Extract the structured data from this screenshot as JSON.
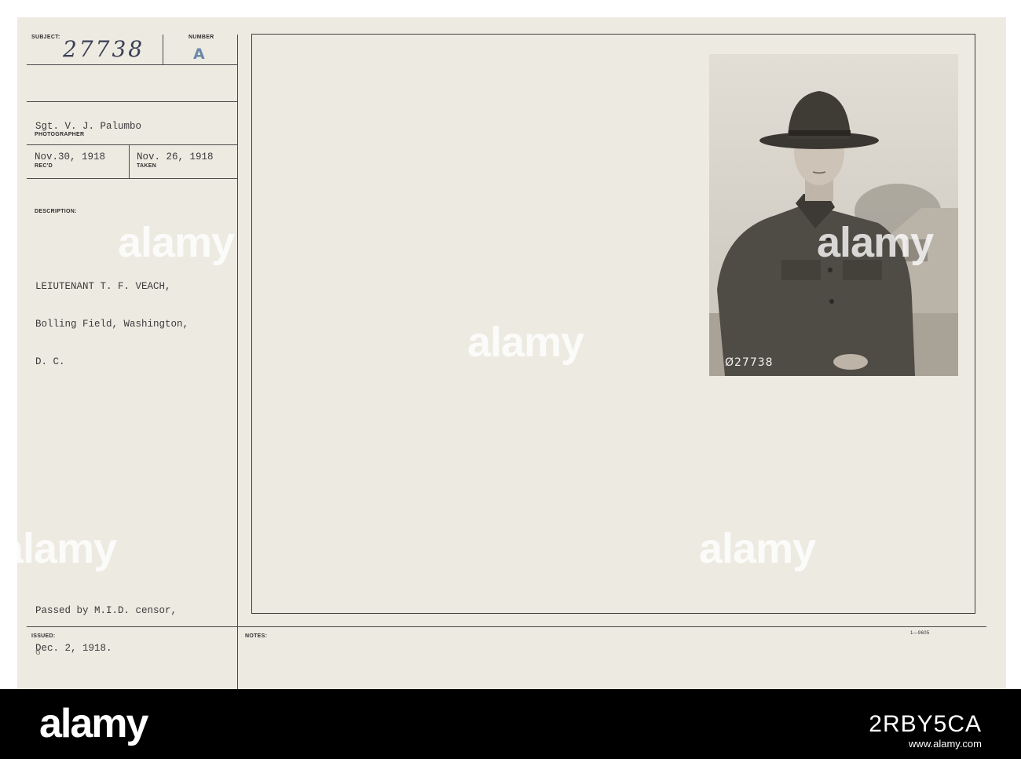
{
  "record": {
    "subject_label": "SUBJECT:",
    "subject_number": "27738",
    "number_label": "NUMBER",
    "number_value": "A",
    "photographer": "Sgt. V. J. Palumbo",
    "photographer_label": "PHOTOGRAPHER",
    "received": "Nov.30, 1918",
    "received_label": "REC'D",
    "taken": "Nov. 26, 1918",
    "taken_label": "TAKEN",
    "description_label": "DESCRIPTION:",
    "description_lines": [
      "LEIUTENANT T. F. VEACH,",
      "Bolling Field, Washington,",
      "D. C."
    ],
    "censor_lines": [
      "Passed by M.I.D. censor,",
      "Dec. 2, 1918."
    ],
    "issued_label": "ISSUED:",
    "issued_mark": "G",
    "notes_label": "NOTES:",
    "form_code": "1—9605"
  },
  "photo": {
    "number": "Ø27738"
  },
  "watermark": {
    "text": "alamy"
  },
  "footer": {
    "logo": "alamy",
    "image_code": "2RBY5CA",
    "site": "www.alamy.com"
  },
  "colors": {
    "card": "#edeae2",
    "rules": "#4a4a4a",
    "type": "#3b3b3b",
    "stamp": "#6c88a8",
    "footer": "#000000"
  }
}
